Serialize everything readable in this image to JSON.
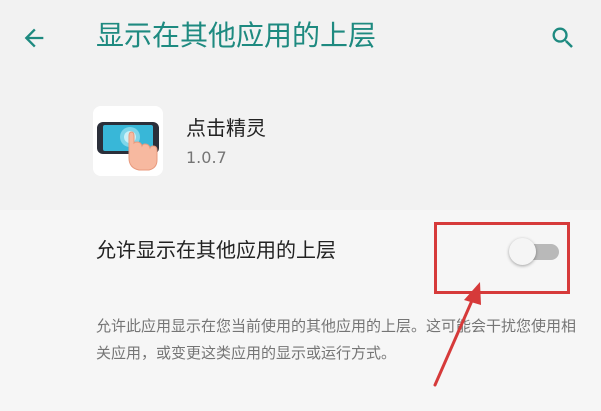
{
  "appbar": {
    "title": "显示在其他应用的上层",
    "back_icon": "arrow-left-icon",
    "search_icon": "search-icon"
  },
  "app": {
    "name": "点击精灵",
    "version": "1.0.7",
    "icon": "touch-phone-app-icon"
  },
  "permission": {
    "toggle_label": "允许显示在其他应用的上层",
    "toggle_enabled": false,
    "description": "允许此应用显示在您当前使用的其他应用的上层。这可能会干扰您使用相关应用，或变更这类应用的显示或运行方式。"
  },
  "colors": {
    "accent": "#1e8a80",
    "background": "#f2f2f2",
    "annotation": "#d63a3a",
    "switch_track_off": "#b9b9b9"
  }
}
